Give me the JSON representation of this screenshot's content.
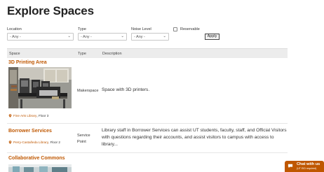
{
  "page": {
    "title": "Explore Spaces"
  },
  "filters": {
    "location": {
      "label": "Location",
      "value": "- Any -"
    },
    "type": {
      "label": "Type",
      "value": "- Any -"
    },
    "noise_level": {
      "label": "Noise Level",
      "value": "- Any -"
    },
    "reservable": {
      "label": "Reservable",
      "checked": false
    },
    "apply_label": "Apply",
    "caret_glyph": "⌄"
  },
  "table": {
    "headers": {
      "space": "Space",
      "type": "Type",
      "description": "Description"
    },
    "rows": [
      {
        "name": "3D Printing Area",
        "type_line1": "Makerspace",
        "type_line2": "",
        "description": "Space with 3D printers.",
        "location_link": "Fine Arts Library",
        "location_floor": ", Floor 3"
      },
      {
        "name": "Borrower Services",
        "type_line1": "Service",
        "type_line2": "Point",
        "description": "Library staff in Borrower Services can assist UT students, faculty, staff, and Official Visitors with questions regarding their accounts, and assist visitors to campus with access to library...",
        "location_link": "Perry-Castañeda Library",
        "location_floor": ", Floor 2"
      },
      {
        "name": "Collaborative Commons",
        "type_line1": "",
        "type_line2": "",
        "description": "",
        "location_link": "",
        "location_floor": ""
      }
    ]
  },
  "chat": {
    "title": "Chat with us",
    "subtitle": "(UT EID required)"
  },
  "colors": {
    "accent": "#bf5700",
    "header_bg": "#ececec",
    "text": "#333333"
  },
  "icons": {
    "pin": "location-pin-icon",
    "chat": "chat-bubble-icon",
    "caret": "chevron-down-icon"
  }
}
